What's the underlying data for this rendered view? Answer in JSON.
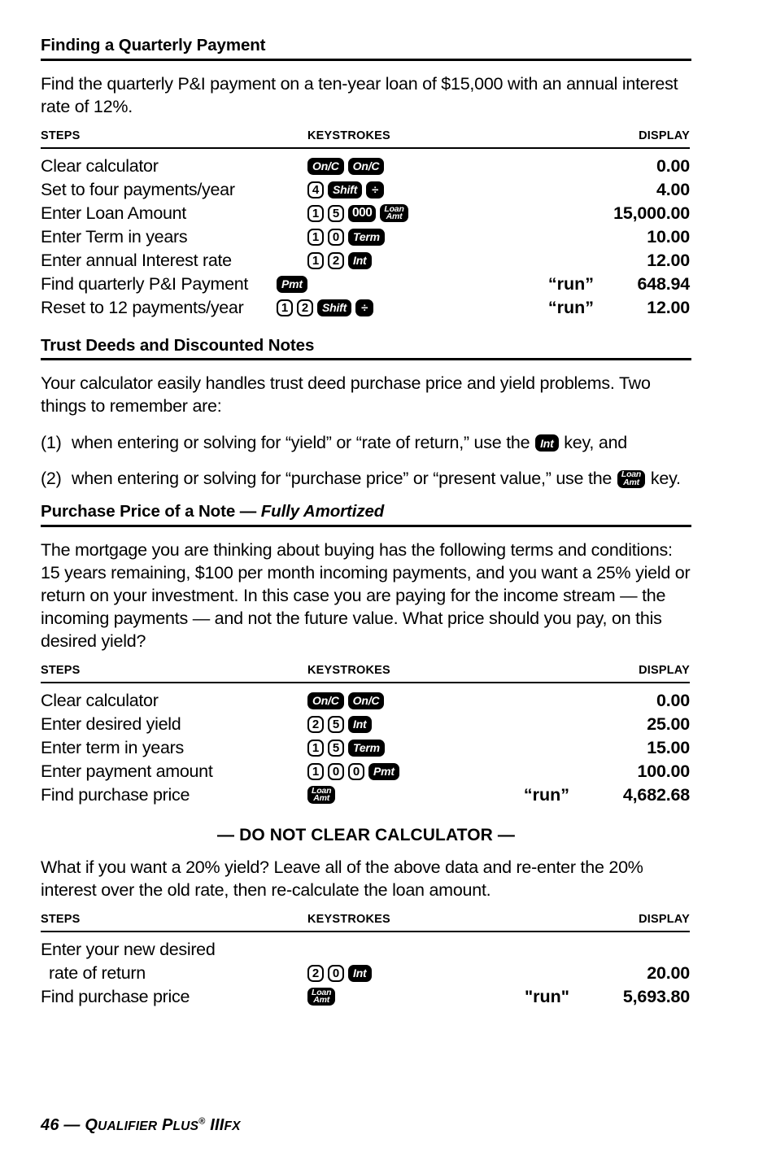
{
  "sections": [
    {
      "heading": "Finding a Quarterly Payment",
      "paragraph": "Find the quarterly P&I payment on a ten-year loan of $15,000 with an annual interest rate of 12%."
    },
    {
      "heading": "Trust Deeds and Discounted Notes",
      "paragraph": "Your calculator easily handles trust deed purchase price and yield problems. Two things to remember are:"
    },
    {
      "heading_prefix": "Purchase Price of a Note — ",
      "heading_italic": "Fully Amortized",
      "paragraph": "The mortgage you are thinking about buying has the following terms and conditions: 15 years remaining, $100 per month incoming payments, and you want a 25% yield or return on your investment. In this case you are paying for the income stream — the incoming payments — and not the future value. What price should you pay, on this desired yield?"
    }
  ],
  "numbered_list": [
    {
      "marker": "(1)",
      "text_before": "when entering or solving for “yield” or “rate of return,” use the ",
      "key": "Int",
      "text_after": " key, and"
    },
    {
      "marker": "(2)",
      "text_before": "when entering or solving for “purchase price” or “present value,” use the ",
      "key_line1": "Loan",
      "key_line2": "Amt",
      "text_after": " key."
    }
  ],
  "banner": "— DO NOT CLEAR CALCULATOR —",
  "banner_paragraph": "What if you want a 20% yield? Leave all of the above data and re-enter the 20% interest over the old rate, then re-calculate the loan amount.",
  "table_headers": {
    "steps": "STEPS",
    "keystrokes": "KEYSTROKES",
    "display": "DISPLAY"
  },
  "tables": [
    {
      "id": "quarterly-payment",
      "rows": [
        {
          "step": "Clear calculator",
          "keys": [
            {
              "t": "fn",
              "label": "On/C"
            },
            {
              "t": "fn",
              "label": "On/C"
            }
          ],
          "run": "",
          "display": "0.00"
        },
        {
          "step": "Set to four payments/year",
          "keys": [
            {
              "t": "num",
              "label": "4"
            },
            {
              "t": "fn",
              "label": "Shift"
            },
            {
              "t": "div",
              "label": "÷"
            }
          ],
          "run": "",
          "display": "4.00"
        },
        {
          "step": "Enter Loan Amount",
          "keys": [
            {
              "t": "num",
              "label": "1"
            },
            {
              "t": "num",
              "label": "5"
            },
            {
              "t": "zeros",
              "label": "000"
            },
            {
              "t": "two",
              "line1": "Loan",
              "line2": "Amt"
            }
          ],
          "run": "",
          "display": "15,000.00"
        },
        {
          "step": "Enter Term in years",
          "keys": [
            {
              "t": "num",
              "label": "1"
            },
            {
              "t": "num",
              "label": "0"
            },
            {
              "t": "fn",
              "label": "Term"
            }
          ],
          "run": "",
          "display": "10.00"
        },
        {
          "step": "Enter annual Interest rate",
          "keys": [
            {
              "t": "num",
              "label": "1"
            },
            {
              "t": "num",
              "label": "2"
            },
            {
              "t": "fn",
              "label": "Int"
            }
          ],
          "run": "",
          "display": "12.00"
        },
        {
          "step": "Find quarterly P&I Payment",
          "keys": [
            {
              "t": "fn",
              "label": "Pmt"
            }
          ],
          "run": "“run”",
          "display": "648.94",
          "keys_shifted": true
        },
        {
          "step": "Reset to 12 payments/year",
          "keys": [
            {
              "t": "num",
              "label": "1"
            },
            {
              "t": "num",
              "label": "2"
            },
            {
              "t": "fn",
              "label": "Shift"
            },
            {
              "t": "div",
              "label": "÷"
            }
          ],
          "run": "“run”",
          "display": "12.00",
          "keys_shifted": true
        }
      ]
    },
    {
      "id": "purchase-price-fully-amortized",
      "rows": [
        {
          "step": "Clear calculator",
          "keys": [
            {
              "t": "fn",
              "label": "On/C"
            },
            {
              "t": "fn",
              "label": "On/C"
            }
          ],
          "run": "",
          "display": "0.00"
        },
        {
          "step": "Enter desired yield",
          "keys": [
            {
              "t": "num",
              "label": "2"
            },
            {
              "t": "num",
              "label": "5"
            },
            {
              "t": "fn",
              "label": "Int"
            }
          ],
          "run": "",
          "display": "25.00"
        },
        {
          "step": "Enter term in years",
          "keys": [
            {
              "t": "num",
              "label": "1"
            },
            {
              "t": "num",
              "label": "5"
            },
            {
              "t": "fn",
              "label": "Term"
            }
          ],
          "run": "",
          "display": "15.00"
        },
        {
          "step": "Enter payment amount",
          "keys": [
            {
              "t": "num",
              "label": "1"
            },
            {
              "t": "num",
              "label": "0"
            },
            {
              "t": "num",
              "label": "0"
            },
            {
              "t": "fn",
              "label": "Pmt"
            }
          ],
          "run": "",
          "display": "100.00"
        },
        {
          "step": "Find purchase price",
          "keys": [
            {
              "t": "two",
              "line1": "Loan",
              "line2": "Amt"
            }
          ],
          "run": "“run”",
          "display": "4,682.68"
        }
      ]
    },
    {
      "id": "purchase-price-new-yield",
      "rows": [
        {
          "step": "Enter your new desired",
          "keys": [],
          "run": "",
          "display": ""
        },
        {
          "step": "rate of return",
          "indent": true,
          "keys": [
            {
              "t": "num",
              "label": "2"
            },
            {
              "t": "num",
              "label": "0"
            },
            {
              "t": "fn",
              "label": "Int"
            }
          ],
          "run": "",
          "display": "20.00"
        },
        {
          "step": "Find purchase price",
          "keys": [
            {
              "t": "two",
              "line1": "Loan",
              "line2": "Amt"
            }
          ],
          "run": "\"run\"",
          "display": "5,693.80"
        }
      ]
    }
  ],
  "footer": {
    "page_number": "46",
    "dash": " — ",
    "q": "Q",
    "ualifier": "UALIFIER",
    "p": " P",
    "lus": "LUS",
    "reg": "®",
    "model": " III",
    "fx": "FX"
  }
}
